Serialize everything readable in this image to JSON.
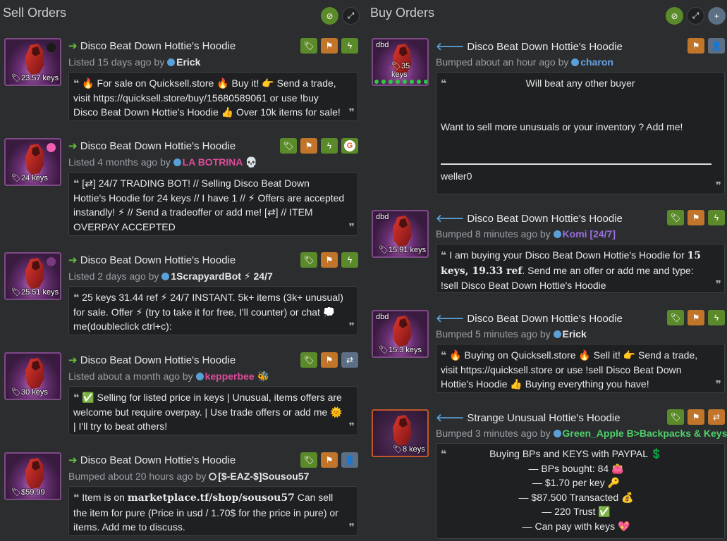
{
  "sell": {
    "title": "Sell Orders",
    "listings": [
      {
        "item_name": "Disco Beat Down Hottie's Hoodie",
        "price": "23.57 keys",
        "meta_prefix": "Listed 15 days ago by",
        "user": "Erick",
        "comment": "🔥 For sale on Quicksell.store 🔥  Buy it!  👉 Send a trade, visit https://quicksell.store/buy/15680589061 or use !buy Disco Beat Down Hottie's Hoodie  👍  Over 10k items for sale!"
      },
      {
        "item_name": "Disco Beat Down Hottie's Hoodie",
        "price": "24 keys",
        "meta_prefix": "Listed 4 months ago by",
        "user": "LA BOTRINA 💀",
        "comment": "[⇄] 24/7 TRADING BOT! // Selling Disco Beat Down Hottie's Hoodie for 24 keys // I have 1 //  ⚡  Offers are accepted instandly!  ⚡  // Send a tradeoffer or add me! [⇄] // ITEM OVERPAY ACCEPTED"
      },
      {
        "item_name": "Disco Beat Down Hottie's Hoodie",
        "price": "25.51 keys",
        "meta_prefix": "Listed 2 days ago by",
        "user": "1ScrapyardBot ⚡ 24/7",
        "comment": "25 keys 31.44 ref ⚡ 24/7 INSTANT. 5k+ items (3k+ unusual) for sale. Offer ⚡ (try to take it for free, I'll counter) or chat 💭 me(doubleclick ctrl+c): buy_Disco_Beat_Down_Hotties_Hoodie"
      },
      {
        "item_name": "Disco Beat Down Hottie's Hoodie",
        "price": "30 keys",
        "meta_prefix": "Listed about a month ago by",
        "user": "kepperbee 🐝",
        "comment": "✅  Selling for listed price in keys | Unusual, items offers are welcome but require overpay. | Use trade offers or add me  🌞  | I'll try to beat others!"
      },
      {
        "item_name": "Disco Beat Down Hottie's Hoodie",
        "price": "$59.99",
        "meta_prefix": "Bumped about 20 hours ago by",
        "user": "[$-EAZ-$]Sousou57",
        "comment_pre": "Item is on ",
        "comment_link": "marketplace.tf/shop/sousou57",
        "comment_post": " Can sell the item for pure (Price in usd / 1.70$ for the price in pure) or items. Add me to discuss."
      }
    ]
  },
  "buy": {
    "title": "Buy Orders",
    "listings": [
      {
        "item_name": "Disco Beat Down Hottie's Hoodie",
        "price": "35 keys",
        "dbd": "dbd",
        "meta_prefix": "Bumped about an hour ago by",
        "user": "charon",
        "comment_line1": "Will beat any other buyer",
        "comment_line2": "Want to sell more unusuals or your inventory ? Add me!",
        "comment_line3": "weller0"
      },
      {
        "item_name": "Disco Beat Down Hottie's Hoodie",
        "price": "15.91 keys",
        "dbd": "dbd",
        "meta_prefix": "Bumped 8 minutes ago by",
        "user": "Komi [24/7]",
        "comment_pre": "I am buying your Disco Beat Down Hottie's Hoodie for ",
        "comment_bold": "15 keys, 19.33 ref",
        "comment_post": ". Send me an offer or add me and type: !sell Disco Beat Down Hottie's Hoodie"
      },
      {
        "item_name": "Disco Beat Down Hottie's Hoodie",
        "price": "15.3 keys",
        "dbd": "dbd",
        "meta_prefix": "Bumped 5 minutes ago by",
        "user": "Erick",
        "comment": "🔥 Buying on Quicksell.store 🔥  Sell it!  👉 Send a trade, visit https://quicksell.store or use !sell Disco Beat Down Hottie's Hoodie  👍  Buying everything you have!"
      },
      {
        "item_name": "Strange Unusual Hottie's Hoodie",
        "price": "8 keys",
        "meta_prefix": "Bumped 3 minutes ago by",
        "user": "Green_Apple B>Backpacks & Keys",
        "lines": [
          "Buying BPs and KEYS with PAYPAL 💲",
          "— BPs bought: 84 👛",
          "— $1.70 per key 🔑",
          "— $87.500 Transacted 💰",
          "— 220 Trust ✅",
          "— Can pay with keys 💖"
        ]
      }
    ]
  },
  "colors": {
    "background": "#2b2d2f",
    "green": "#5b8a2a",
    "orange": "#c0752a",
    "blue_gray": "#5c6f85"
  },
  "icons": {
    "header_buttons": [
      "eye-slash-icon",
      "expand-icon",
      "plus-icon"
    ],
    "badges": [
      "price-tag-icon",
      "flag-icon",
      "lightning-icon",
      "exchange-icon",
      "add-friend-icon",
      "g-logo-icon"
    ]
  }
}
